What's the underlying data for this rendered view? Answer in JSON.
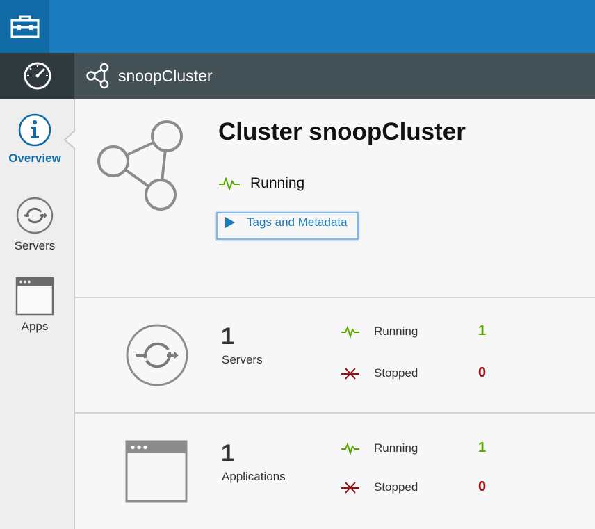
{
  "header": {
    "breadcrumb": "snoopCluster",
    "toolbox_icon": "toolbox-icon",
    "dashboard_icon": "dashboard-gauge-icon"
  },
  "sidebar": {
    "items": [
      {
        "label": "Overview",
        "icon": "info-icon",
        "active": true
      },
      {
        "label": "Servers",
        "icon": "server-sync-icon"
      },
      {
        "label": "Apps",
        "icon": "app-window-icon"
      }
    ]
  },
  "overview": {
    "title": "Cluster snoopCluster",
    "status": "Running",
    "tags_label": "Tags and Metadata"
  },
  "servers": {
    "count": "1",
    "label": "Servers",
    "running_label": "Running",
    "running_count": "1",
    "stopped_label": "Stopped",
    "stopped_count": "0"
  },
  "applications": {
    "count": "1",
    "label": "Applications",
    "running_label": "Running",
    "running_count": "1",
    "stopped_label": "Stopped",
    "stopped_count": "0"
  },
  "colors": {
    "accent": "#1a7cbc",
    "running": "#5aa700",
    "stopped": "#9a1010"
  }
}
